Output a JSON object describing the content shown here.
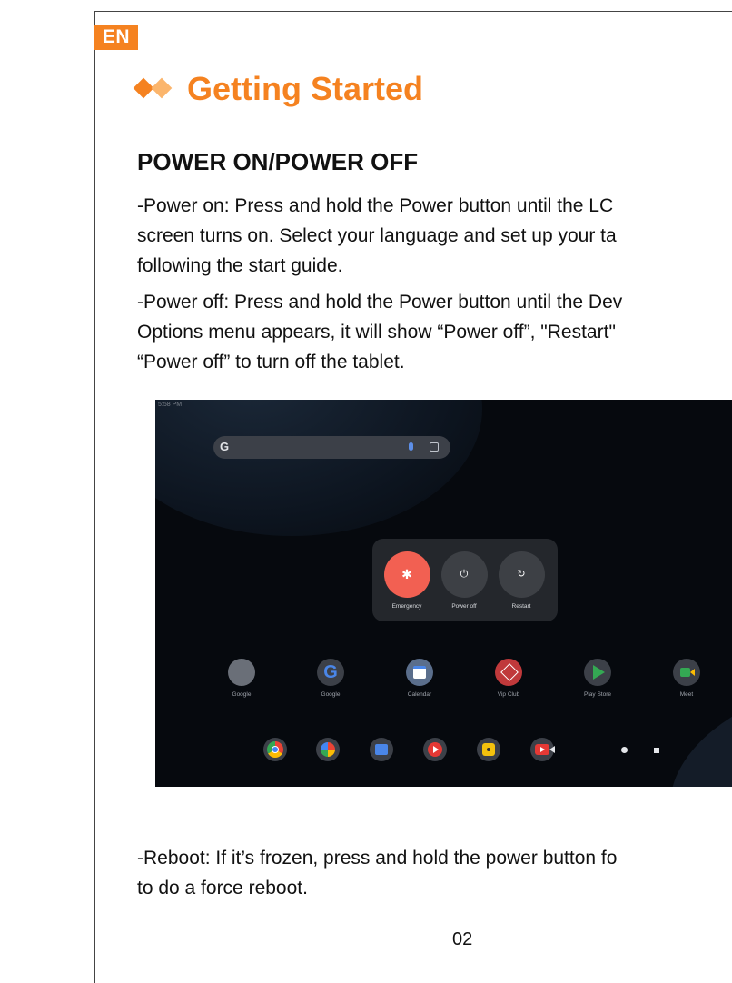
{
  "language_badge": "EN",
  "section": {
    "title": "Getting Started"
  },
  "heading": "POWER ON/POWER OFF",
  "paragraphs": {
    "power_on": [
      "-Power on: Press and hold the Power button until the LC",
      "screen turns on. Select your language and set up your ta",
      "following the start guide."
    ],
    "power_off": [
      "-Power off: Press and hold the Power button until the Dev",
      "Options menu appears, it will show “Power off”, \"Restart\"",
      "“Power off” to turn off the tablet."
    ],
    "reboot": [
      "-Reboot: If it’s frozen, press and hold the power button fo",
      "to do a force reboot."
    ]
  },
  "tablet_screen": {
    "status_time": "5:58 PM",
    "search_logo": "G",
    "power_menu": [
      {
        "label": "Emergency",
        "icon": "asterisk-icon",
        "glyph": "✱",
        "color": "#f26052"
      },
      {
        "label": "Power off",
        "icon": "power-icon",
        "glyph": "⏻",
        "color": "#3d4045"
      },
      {
        "label": "Restart",
        "icon": "restart-icon",
        "glyph": "↻",
        "color": "#3d4045"
      }
    ],
    "apps": [
      {
        "label": "Google",
        "icon": "google-folder-icon"
      },
      {
        "label": "Google",
        "icon": "google-g-icon"
      },
      {
        "label": "Calendar",
        "icon": "calendar-icon"
      },
      {
        "label": "Vip Club",
        "icon": "vip-club-icon"
      },
      {
        "label": "Play Store",
        "icon": "play-store-icon"
      },
      {
        "label": "Meet",
        "icon": "meet-icon"
      }
    ],
    "dock": [
      {
        "icon": "chrome-icon"
      },
      {
        "icon": "photos-icon"
      },
      {
        "icon": "files-icon"
      },
      {
        "icon": "youtube-music-icon"
      },
      {
        "icon": "camera-icon"
      },
      {
        "icon": "youtube-icon"
      }
    ]
  },
  "page_number": "02",
  "colors": {
    "accent": "#f58220",
    "accent_light": "#fbb56c"
  }
}
